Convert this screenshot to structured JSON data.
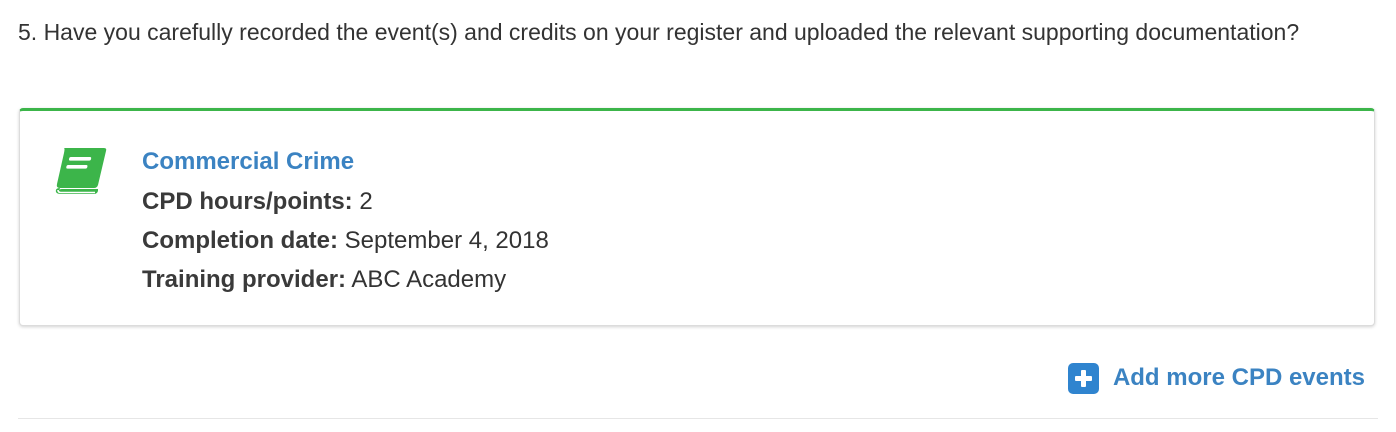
{
  "question": {
    "text": "5. Have you carefully recorded the event(s) and credits on your register and uploaded the relevant supporting documentation?"
  },
  "event": {
    "icon": "book-icon",
    "title": "Commercial Crime",
    "hours_label": "CPD hours/points:",
    "hours_value": "2",
    "date_label": "Completion date:",
    "date_value": "September 4, 2018",
    "provider_label": "Training provider:",
    "provider_value": "ABC Academy"
  },
  "actions": {
    "add_more_icon": "plus-square-icon",
    "add_more_label": "Add more CPD events"
  },
  "colors": {
    "accent_green": "#3cb54a",
    "link_blue": "#3b83c2",
    "plus_blue": "#2f84cf",
    "text": "#333333"
  }
}
